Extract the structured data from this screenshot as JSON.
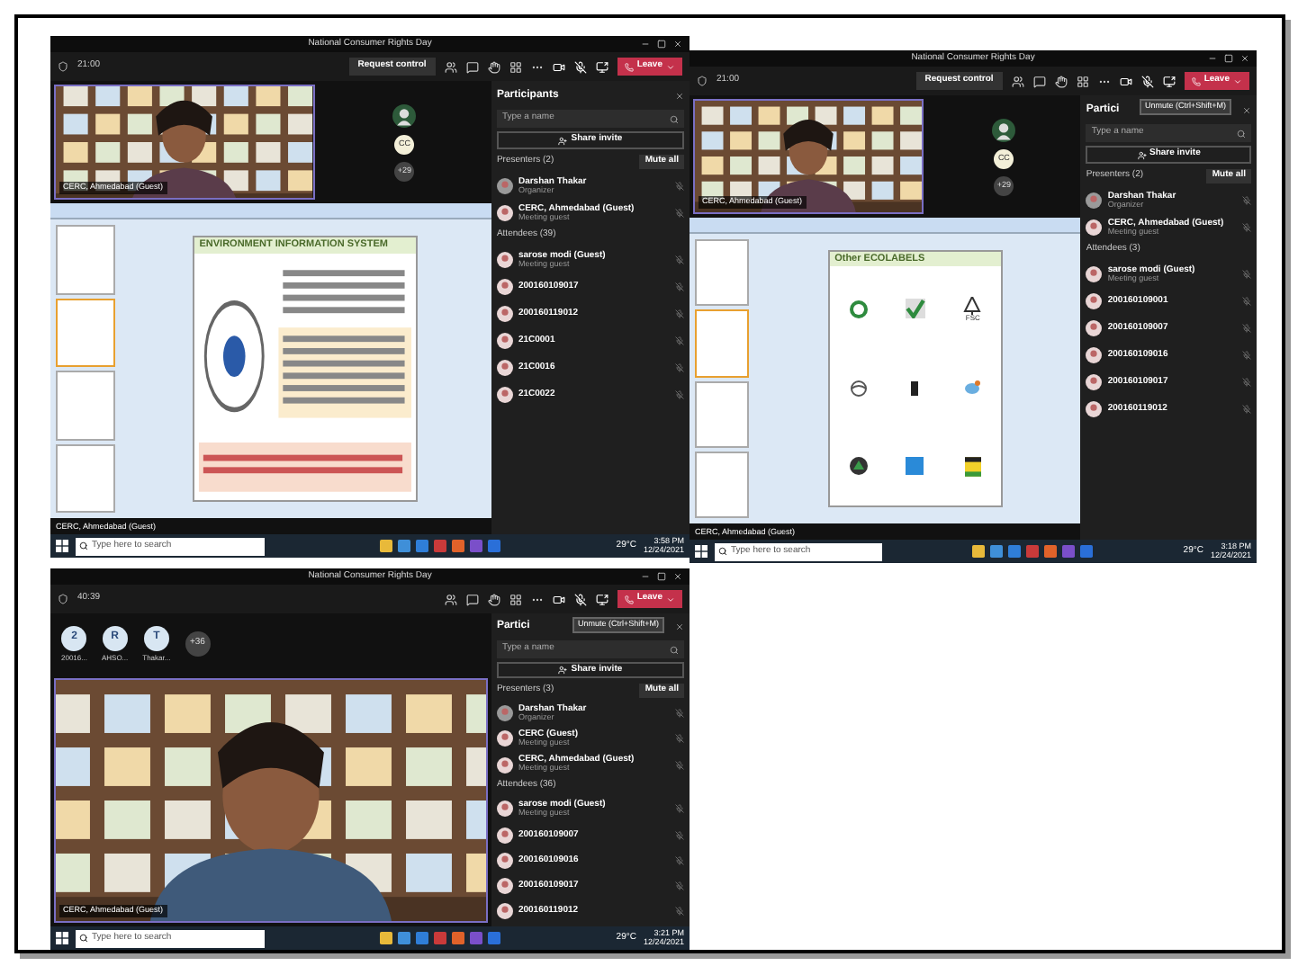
{
  "screenshots": [
    {
      "kind": "slides",
      "window_title": "National Consumer Rights Day",
      "timer": "21:00",
      "request_control": "Request control",
      "leave": "Leave",
      "video_label": "CERC, Ahmedabad (Guest)",
      "avatars": [
        {
          "kind": "picture"
        },
        {
          "kind": "initials",
          "text": "CC"
        },
        {
          "kind": "more",
          "text": "+29"
        }
      ],
      "slide": {
        "kind": "text",
        "title": "ENVIRONMENT INFORMATION SYSTEM"
      },
      "stage_label": "CERC, Ahmedabad (Guest)",
      "panel": {
        "title": "Participants",
        "search": "Type a name",
        "share": "Share invite",
        "presenters": "Presenters (2)",
        "mute_all": "Mute all",
        "presenter_list": [
          {
            "name": "Darshan Thakar",
            "role": "Organizer"
          },
          {
            "name": "CERC, Ahmedabad (Guest)",
            "role": "Meeting guest"
          }
        ],
        "attendees": "Attendees (39)",
        "attendee_list": [
          {
            "name": "sarose modi (Guest)",
            "role": "Meeting guest"
          },
          {
            "name": "200160109017"
          },
          {
            "name": "200160119012"
          },
          {
            "name": "21C0001"
          },
          {
            "name": "21C0016"
          },
          {
            "name": "21C0022"
          }
        ]
      },
      "taskbar": {
        "search": "Type here to search",
        "weather": "29°C",
        "time": "3:58 PM",
        "date": "12/24/2021"
      }
    },
    {
      "kind": "slides",
      "window_title": "National Consumer Rights Day",
      "timer": "21:00",
      "request_control": "Request control",
      "leave": "Leave",
      "video_label": "CERC, Ahmedabad (Guest)",
      "avatars": [
        {
          "kind": "picture"
        },
        {
          "kind": "initials",
          "text": "CC"
        },
        {
          "kind": "more",
          "text": "+29"
        }
      ],
      "slide": {
        "kind": "logos",
        "title": "Other ECOLABELS",
        "label": "FSC"
      },
      "stage_label": "CERC, Ahmedabad (Guest)",
      "tooltip": "Unmute (Ctrl+Shift+M)",
      "panel": {
        "title": "Partici",
        "search": "Type a name",
        "share": "Share invite",
        "presenters": "Presenters (2)",
        "mute_all": "Mute all",
        "presenter_list": [
          {
            "name": "Darshan Thakar",
            "role": "Organizer"
          },
          {
            "name": "CERC, Ahmedabad (Guest)",
            "role": "Meeting guest"
          }
        ],
        "attendees": "Attendees (3)",
        "attendee_list": [
          {
            "name": "sarose modi (Guest)",
            "role": "Meeting guest"
          },
          {
            "name": "200160109001"
          },
          {
            "name": "200160109007"
          },
          {
            "name": "200160109016"
          },
          {
            "name": "200160109017"
          },
          {
            "name": "200160119012"
          }
        ]
      },
      "taskbar": {
        "search": "Type here to search",
        "weather": "29°C",
        "time": "3:18 PM",
        "date": "12/24/2021"
      }
    },
    {
      "kind": "video",
      "window_title": "National Consumer Rights Day",
      "timer": "40:39",
      "leave": "Leave",
      "tiles": [
        {
          "initial": "2",
          "label": "20016..."
        },
        {
          "initial": "R",
          "label": "AHSO..."
        },
        {
          "initial": "T",
          "label": "Thakar..."
        }
      ],
      "more": "+36",
      "stage_label": "CERC, Ahmedabad (Guest)",
      "tooltip": "Unmute (Ctrl+Shift+M)",
      "panel": {
        "title": "Partici",
        "search": "Type a name",
        "share": "Share invite",
        "presenters": "Presenters (3)",
        "mute_all": "Mute all",
        "presenter_list": [
          {
            "name": "Darshan Thakar",
            "role": "Organizer"
          },
          {
            "name": "CERC (Guest)",
            "role": "Meeting guest"
          },
          {
            "name": "CERC, Ahmedabad (Guest)",
            "role": "Meeting guest"
          }
        ],
        "attendees": "Attendees (36)",
        "attendee_list": [
          {
            "name": "sarose modi (Guest)",
            "role": "Meeting guest"
          },
          {
            "name": "200160109007"
          },
          {
            "name": "200160109016"
          },
          {
            "name": "200160109017"
          },
          {
            "name": "200160119012"
          }
        ]
      },
      "taskbar": {
        "search": "Type here to search",
        "weather": "29°C",
        "time": "3:21 PM",
        "date": "12/24/2021"
      }
    }
  ]
}
